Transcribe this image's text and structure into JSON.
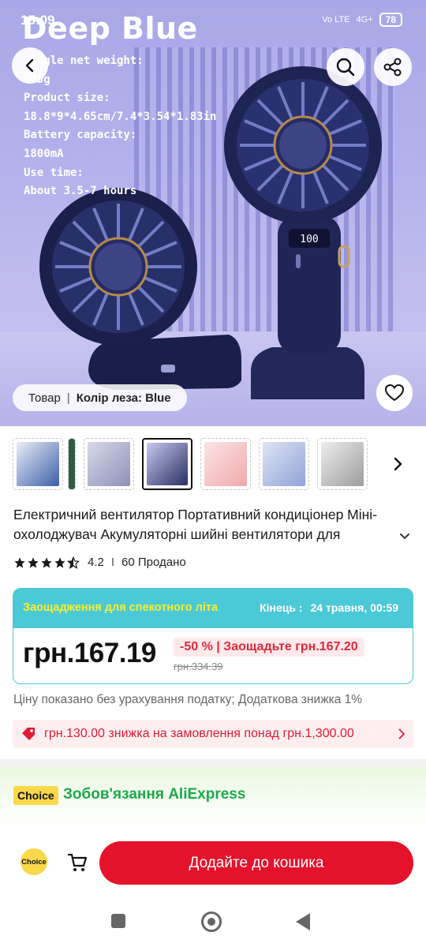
{
  "status_bar": {
    "time": "15:09",
    "network": "4G+",
    "volte": "Vo LTE",
    "battery": "78"
  },
  "hero": {
    "brand": "Deep Blue",
    "specs": [
      "Single net weight:",
      "175g",
      "Product size:",
      "18.8*9*4.65cm/7.4*3.54*1.83in",
      "Battery capacity:",
      "1800mA",
      "Use time:",
      "About 3.5-7 hours"
    ],
    "display_digits": "100"
  },
  "variant_pill": {
    "label": "Товар",
    "option": "Колір леза: Blue"
  },
  "thumbnails": {
    "count": 8,
    "selected_index": 3,
    "items": [
      {
        "color": "#3d5fa8"
      },
      {
        "color": "#2f5a44"
      },
      {
        "color": "#aeb0cc"
      },
      {
        "color": "#2a2f63"
      },
      {
        "color": "#f3c3c4"
      },
      {
        "color": "#b8c4e8"
      },
      {
        "color": "#c9c9c9"
      },
      {
        "color": "#ffffff"
      }
    ]
  },
  "product": {
    "title": "Електричний вентилятор Портативний кондиціонер Міні-охолоджувач Акумуляторні шийні вентилятори для",
    "rating": "4.2",
    "sold": "60 Продано",
    "stars_full": 4,
    "stars_half": 0.5
  },
  "promo": {
    "title": "Заощадження для спекотного літа",
    "ends_label": "Кінець :",
    "ends_value": "24 травня, 00:59",
    "price": "грн.167.19",
    "discount": "-50 % | Заощадьте грн.167.20",
    "original_price": "грн.334.39"
  },
  "tax_note": "Ціну показано без урахування податку; Додаткова знижка 1%",
  "coupon": {
    "text": "грн.130.00 знижка на замовлення понад грн.1,300.00"
  },
  "choice": {
    "badge": "Choice",
    "text": "Зобов'язання AliExpress"
  },
  "bottom_bar": {
    "choice_icon_label": "Choice",
    "add_to_cart": "Додайте до кошика"
  },
  "colors": {
    "accent_red": "#e5122b",
    "teal": "#4cc9d6",
    "choice_yellow": "#f9d94a",
    "choice_green": "#1ba94c"
  }
}
